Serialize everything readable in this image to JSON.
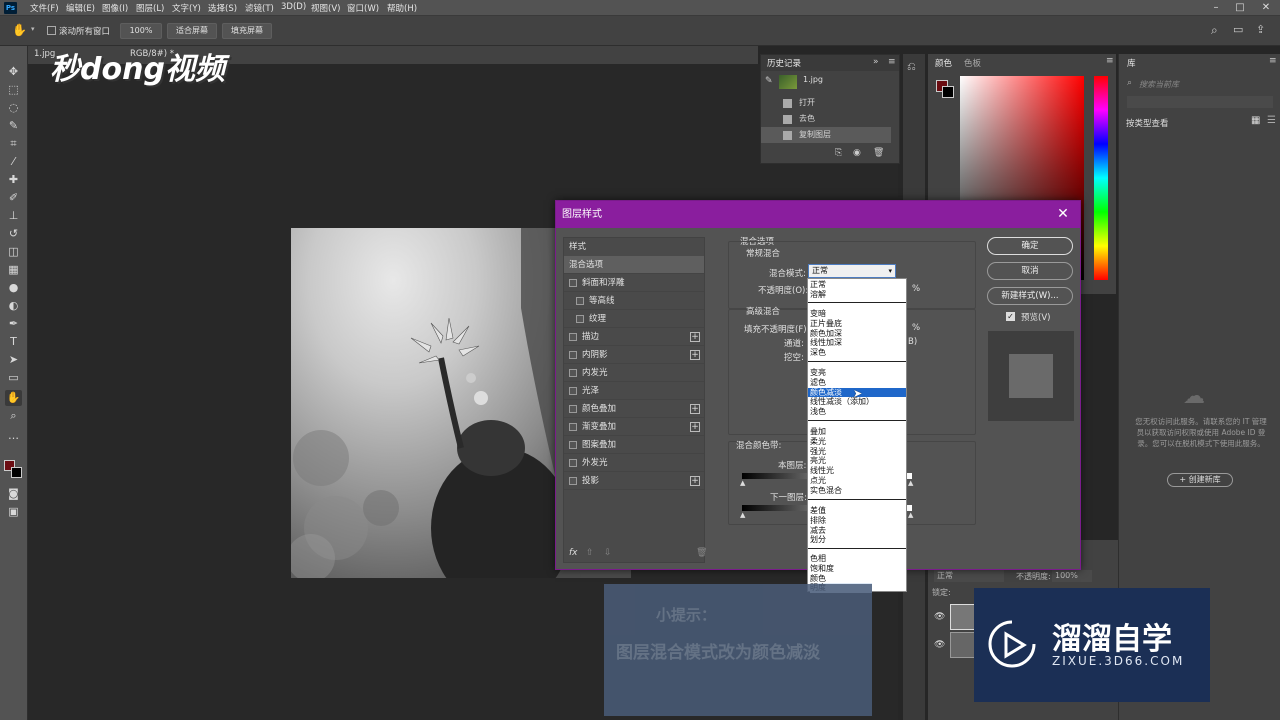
{
  "menubar": {
    "items": [
      "文件(F)",
      "编辑(E)",
      "图像(I)",
      "图层(L)",
      "文字(Y)",
      "选择(S)",
      "滤镜(T)",
      "3D(D)",
      "视图(V)",
      "窗口(W)",
      "帮助(H)"
    ]
  },
  "options": {
    "scroll_all": "滚动所有窗口",
    "zoom": "100%",
    "fit_screen": "适合屏幕",
    "fill_screen": "填充屏幕"
  },
  "document": {
    "tab": "1.jpg",
    "mode": "RGB/8#) *"
  },
  "watermark_top": "秒dong视频",
  "history": {
    "title": "历史记录",
    "snapshot": "1.jpg",
    "items": [
      "打开",
      "去色",
      "复制图层"
    ]
  },
  "color_panel": {
    "tab_color": "颜色",
    "tab_swatches": "色板",
    "fg_color": "#6b0d12",
    "bg_color": "#000000"
  },
  "library": {
    "title": "库",
    "search_placeholder": "搜索当前库",
    "view_by": "按类型查看",
    "offline_msg": "您无权访问此服务。请联系您的 IT 管理员以获取访问权限或使用 Adobe ID 登录。您可以在脱机模式下使用此服务。",
    "create_btn": "+ 创建新库"
  },
  "layers": {
    "blend": "正常",
    "opacity_label": "不透明度:",
    "opacity": "100%",
    "lock_label": "锁定:"
  },
  "dialog": {
    "title": "图层样式",
    "style_header": "样式",
    "styles": [
      {
        "label": "混合选项",
        "check": false,
        "plus": false,
        "active": true
      },
      {
        "label": "斜面和浮雕",
        "check": true,
        "plus": false
      },
      {
        "label": "等高线",
        "check": true,
        "plus": false,
        "indent": true
      },
      {
        "label": "纹理",
        "check": true,
        "plus": false,
        "indent": true
      },
      {
        "label": "描边",
        "check": true,
        "plus": true
      },
      {
        "label": "内阴影",
        "check": true,
        "plus": true
      },
      {
        "label": "内发光",
        "check": true,
        "plus": false
      },
      {
        "label": "光泽",
        "check": true,
        "plus": false
      },
      {
        "label": "颜色叠加",
        "check": true,
        "plus": true
      },
      {
        "label": "渐变叠加",
        "check": true,
        "plus": true
      },
      {
        "label": "图案叠加",
        "check": true,
        "plus": false
      },
      {
        "label": "外发光",
        "check": true,
        "plus": false
      },
      {
        "label": "投影",
        "check": true,
        "plus": true
      }
    ],
    "blend_options_title": "混合选项",
    "general_blend": "常规混合",
    "blend_mode_label": "混合模式:",
    "blend_mode_value": "正常",
    "opacity_label": "不透明度(O):",
    "percent": "%",
    "advanced_blend": "高级混合",
    "fill_opacity_label": "填充不透明度(F):",
    "channels_label": "通道:",
    "channel_b": "B)",
    "knockout_label": "挖空:",
    "blend_if_label": "混合颜色带:",
    "this_layer": "本图层:",
    "underlying": "下一图层:",
    "ok": "确定",
    "cancel": "取消",
    "new_style": "新建样式(W)...",
    "preview": "预览(V)"
  },
  "blend_list": {
    "groups": [
      [
        "正常",
        "溶解"
      ],
      [
        "变暗",
        "正片叠底",
        "颜色加深",
        "线性加深",
        "深色"
      ],
      [
        "变亮",
        "滤色",
        "颜色减淡",
        "线性减淡（添加）",
        "浅色"
      ],
      [
        "叠加",
        "柔光",
        "强光",
        "亮光",
        "线性光",
        "点光",
        "实色混合"
      ],
      [
        "差值",
        "排除",
        "减去",
        "划分"
      ],
      [
        "色相",
        "饱和度",
        "颜色",
        "明度"
      ]
    ],
    "selected": "颜色减淡"
  },
  "tip": {
    "title": "小提示：",
    "text": "图层混合模式改为颜色减淡"
  },
  "watermark": {
    "brand": "溜溜自学",
    "url": "ZIXUE.3D66.COM"
  }
}
